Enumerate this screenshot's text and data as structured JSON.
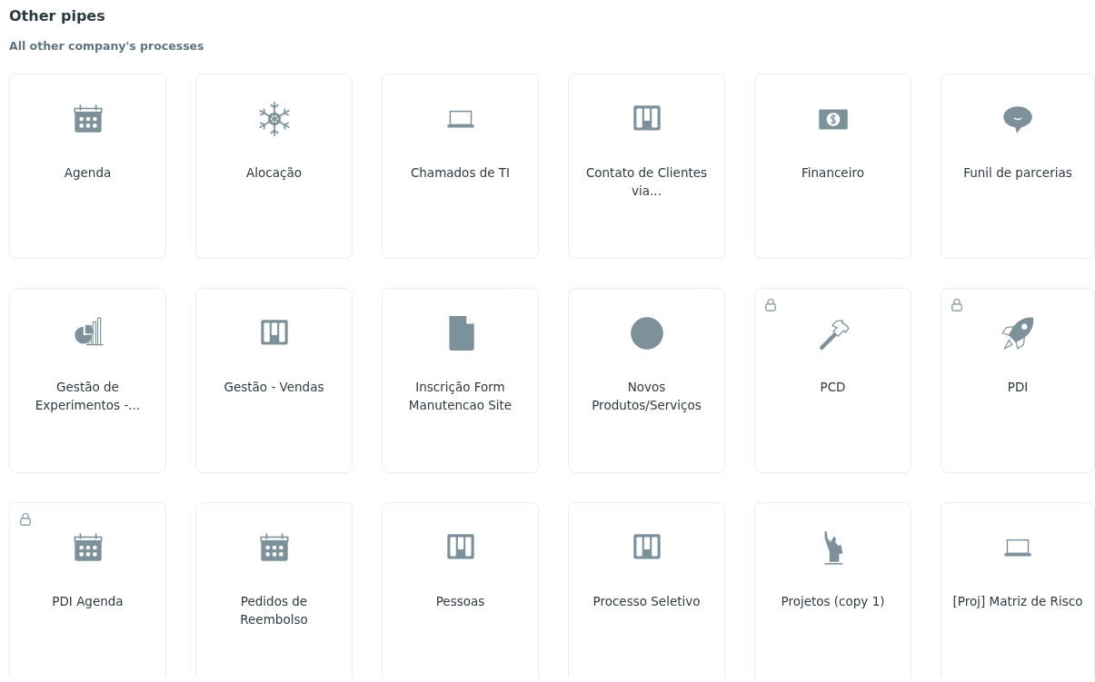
{
  "header": {
    "title": "Other pipes",
    "subtitle": "All other company's processes"
  },
  "pipes": [
    {
      "name": "Agenda",
      "locked": false
    },
    {
      "name": "Alocação",
      "locked": false
    },
    {
      "name": "Chamados de TI",
      "locked": false
    },
    {
      "name": "Contato de Clientes via...",
      "locked": false
    },
    {
      "name": "Financeiro",
      "locked": false
    },
    {
      "name": "Funil de parcerias",
      "locked": false
    },
    {
      "name": "Gestão de Experimentos -...",
      "locked": false
    },
    {
      "name": "Gestão - Vendas",
      "locked": false
    },
    {
      "name": "Inscrição Form Manutencao Site",
      "locked": false
    },
    {
      "name": "Novos Produtos/Serviços",
      "locked": false
    },
    {
      "name": "PCD",
      "locked": true
    },
    {
      "name": "PDI",
      "locked": true
    },
    {
      "name": "PDI Agenda",
      "locked": true
    },
    {
      "name": "Pedidos de Reembolso",
      "locked": false
    },
    {
      "name": "Pessoas",
      "locked": false
    },
    {
      "name": "Processo Seletivo",
      "locked": false
    },
    {
      "name": "Projetos (copy 1)",
      "locked": false
    },
    {
      "name": "[Proj] Matriz de Risco",
      "locked": false
    }
  ]
}
